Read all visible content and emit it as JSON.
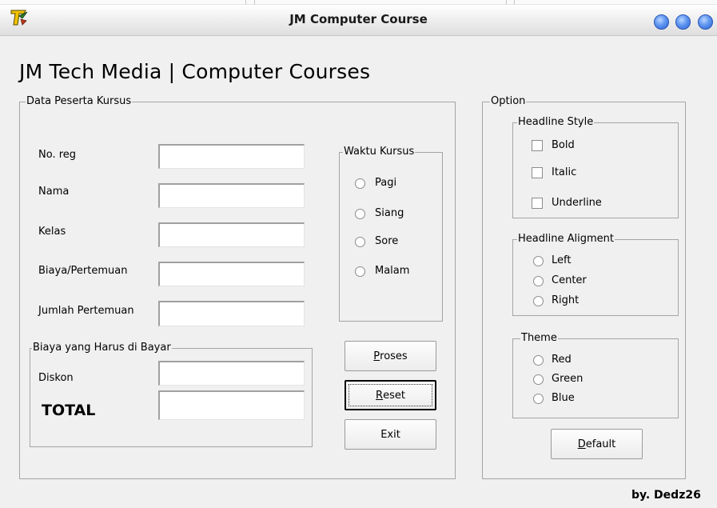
{
  "window": {
    "title": "JM Computer Course"
  },
  "headline": "JM Tech Media | Computer  Courses",
  "peserta": {
    "group_label": "Data Peserta Kursus",
    "fields": [
      {
        "label": "No. reg",
        "value": ""
      },
      {
        "label": "Nama",
        "value": ""
      },
      {
        "label": "Kelas",
        "value": ""
      },
      {
        "label": "Biaya/Pertemuan",
        "value": ""
      },
      {
        "label": "Jumlah Pertemuan",
        "value": ""
      }
    ],
    "waktu": {
      "group_label": "Waktu Kursus",
      "options": [
        "Pagi",
        "Siang",
        "Sore",
        "Malam"
      ]
    },
    "bayar": {
      "group_label": "Biaya yang Harus di Bayar",
      "diskon_label": "Diskon",
      "diskon_value": "",
      "total_label": "TOTAL",
      "total_value": ""
    },
    "buttons": {
      "proses_u": "P",
      "proses_rest": "roses",
      "reset_u": "R",
      "reset_rest": "eset",
      "exit": "Exit"
    }
  },
  "option": {
    "group_label": "Option",
    "style": {
      "group_label": "Headline Style",
      "options": [
        "Bold",
        "Italic",
        "Underline"
      ]
    },
    "align": {
      "group_label": "Headline Aligment",
      "options": [
        "Left",
        "Center",
        "Right"
      ]
    },
    "theme": {
      "group_label": "Theme",
      "options": [
        "Red",
        "Green",
        "Blue"
      ]
    },
    "default_u": "D",
    "default_rest": "efault"
  },
  "credit": "by. Dedz26",
  "icons": {
    "app": "app-logo-icon",
    "window_controls": [
      "minimize-icon",
      "maximize-icon",
      "close-icon"
    ]
  },
  "colors": {
    "window_button": "#3f7be6",
    "background": "#f0f0f0"
  }
}
